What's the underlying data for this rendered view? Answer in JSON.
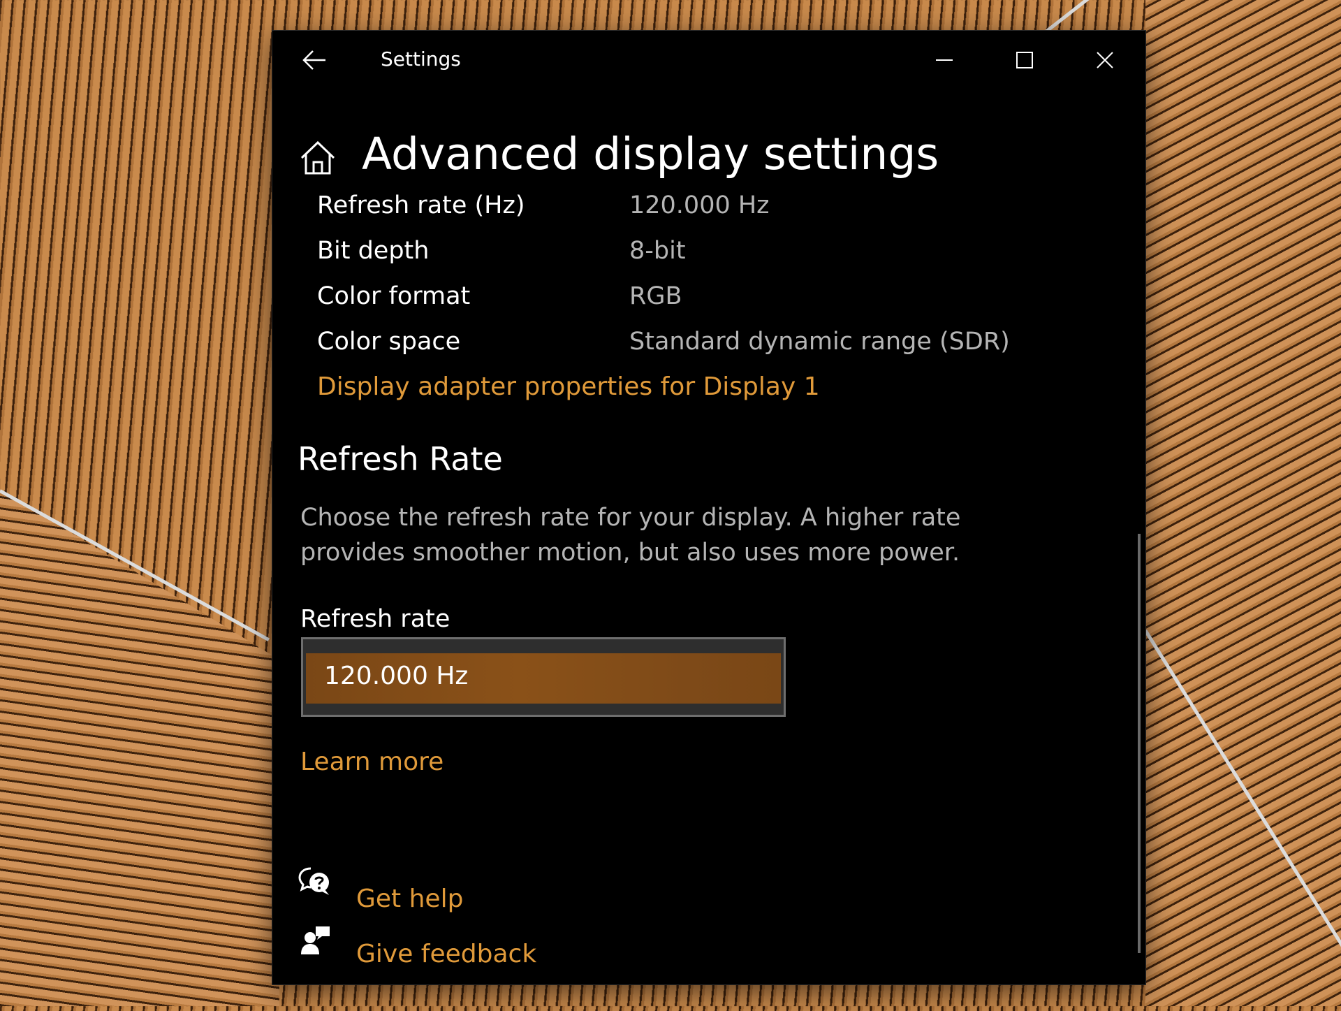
{
  "window": {
    "title": "Settings"
  },
  "page": {
    "title": "Advanced display settings"
  },
  "display_info": {
    "rows": [
      {
        "label": "Refresh rate (Hz)",
        "value": "120.000 Hz"
      },
      {
        "label": "Bit depth",
        "value": "8-bit"
      },
      {
        "label": "Color format",
        "value": "RGB"
      },
      {
        "label": "Color space",
        "value": "Standard dynamic range (SDR)"
      }
    ],
    "adapter_link": "Display adapter properties for Display 1"
  },
  "refresh_section": {
    "title": "Refresh Rate",
    "description": "Choose the refresh rate for your display. A higher rate provides smoother motion, but also uses more power.",
    "field_label": "Refresh rate",
    "selected_value": "120.000 Hz",
    "learn_more": "Learn more"
  },
  "footer": {
    "get_help": "Get help",
    "give_feedback": "Give feedback"
  },
  "colors": {
    "window_bg": "#000000",
    "accent_link": "#e09a3a",
    "dropdown_fill": "#8a5118",
    "secondary_text": "#b5b5b5"
  },
  "icons": {
    "back": "arrow-left-icon",
    "minimize": "minimize-icon",
    "maximize": "maximize-icon",
    "close": "close-icon",
    "home": "home-icon",
    "help": "help-chat-icon",
    "feedback": "feedback-person-icon"
  }
}
